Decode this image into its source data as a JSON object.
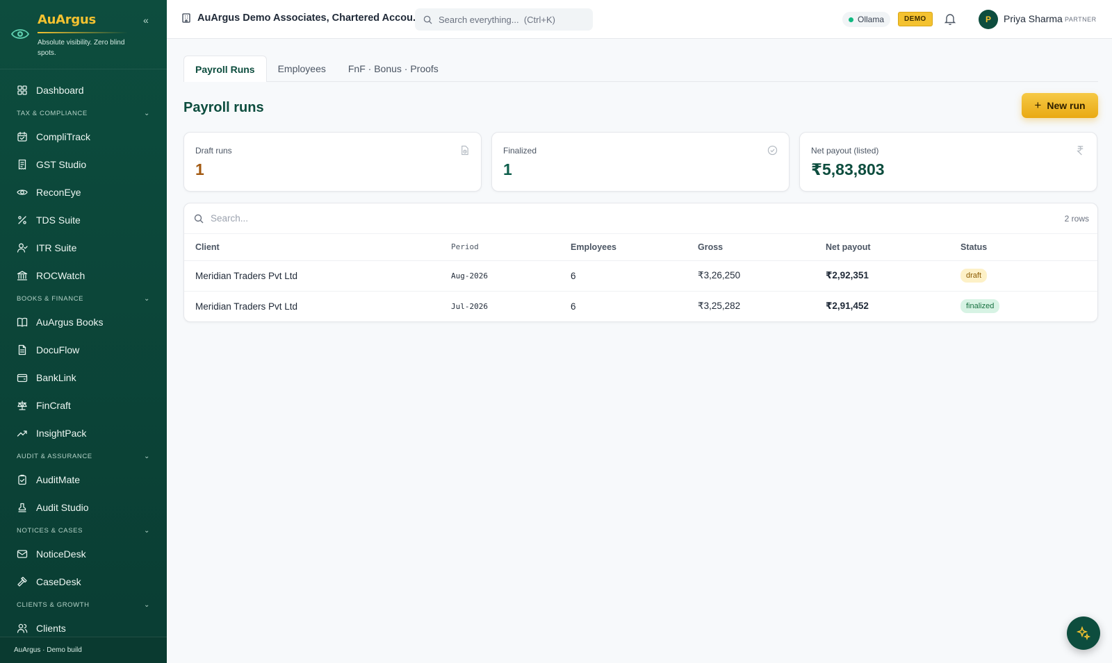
{
  "brand": {
    "name": "AuArgus",
    "tagline": "Absolute visibility. Zero blind spots.",
    "footer": "AuArgus · Demo build"
  },
  "sidebar": {
    "items": [
      {
        "type": "item",
        "label": "Dashboard",
        "icon": "grid-icon"
      },
      {
        "type": "section",
        "label": "Tax & Compliance"
      },
      {
        "type": "item",
        "label": "CompliTrack",
        "icon": "calendar-check-icon"
      },
      {
        "type": "item",
        "label": "GST Studio",
        "icon": "receipt-icon"
      },
      {
        "type": "item",
        "label": "ReconEye",
        "icon": "eye-icon"
      },
      {
        "type": "item",
        "label": "TDS Suite",
        "icon": "percent-icon"
      },
      {
        "type": "item",
        "label": "ITR Suite",
        "icon": "user-check-icon"
      },
      {
        "type": "item",
        "label": "ROCWatch",
        "icon": "bank-building-icon"
      },
      {
        "type": "section",
        "label": "Books & Finance"
      },
      {
        "type": "item",
        "label": "AuArgus Books",
        "icon": "book-open-icon"
      },
      {
        "type": "item",
        "label": "DocuFlow",
        "icon": "file-text-icon"
      },
      {
        "type": "item",
        "label": "BankLink",
        "icon": "wallet-icon"
      },
      {
        "type": "item",
        "label": "FinCraft",
        "icon": "scale-icon"
      },
      {
        "type": "item",
        "label": "InsightPack",
        "icon": "trending-up-icon"
      },
      {
        "type": "section",
        "label": "Audit & Assurance"
      },
      {
        "type": "item",
        "label": "AuditMate",
        "icon": "clipboard-check-icon"
      },
      {
        "type": "item",
        "label": "Audit Studio",
        "icon": "stamp-icon"
      },
      {
        "type": "section",
        "label": "Notices & Cases"
      },
      {
        "type": "item",
        "label": "NoticeDesk",
        "icon": "mail-icon"
      },
      {
        "type": "item",
        "label": "CaseDesk",
        "icon": "gavel-icon"
      },
      {
        "type": "section",
        "label": "Clients & Growth"
      },
      {
        "type": "item",
        "label": "Clients",
        "icon": "users-icon"
      }
    ]
  },
  "header": {
    "org_name": "AuArgus Demo Associates, Chartered Accou...",
    "search_placeholder": "Search everything...  (Ctrl+K)",
    "ollama_label": "Ollama",
    "demo_badge": "DEMO",
    "user_initial": "P",
    "user_name": "Priya Sharma",
    "user_role": "PARTNER"
  },
  "tabs": [
    {
      "label": "Payroll Runs",
      "active": true
    },
    {
      "label": "Employees",
      "active": false
    },
    {
      "label": "FnF · Bonus · Proofs",
      "active": false
    }
  ],
  "page": {
    "title": "Payroll runs",
    "new_run_label": "New run"
  },
  "stats": [
    {
      "label": "Draft runs",
      "value": "1",
      "color": "#a35a12",
      "icon": "draft-icon"
    },
    {
      "label": "Finalized",
      "value": "1",
      "color": "#0d5e4b",
      "icon": "check-circle-icon"
    },
    {
      "label": "Net payout (listed)",
      "value": "₹5,83,803",
      "color": "#0d4d3e",
      "icon": "rupee-icon"
    }
  ],
  "table": {
    "search_placeholder": "Search...",
    "rows_count": "2 rows",
    "columns": [
      "Client",
      "Period",
      "Employees",
      "Gross",
      "Net payout",
      "Status"
    ],
    "rows": [
      {
        "client": "Meridian Traders Pvt Ltd",
        "period": "Aug-2026",
        "employees": "6",
        "gross": "₹3,26,250",
        "net": "₹2,92,351",
        "status": "draft"
      },
      {
        "client": "Meridian Traders Pvt Ltd",
        "period": "Jul-2026",
        "employees": "6",
        "gross": "₹3,25,282",
        "net": "₹2,91,452",
        "status": "finalized"
      }
    ]
  },
  "colors": {
    "sidebar_bg": "#0d4d3e",
    "accent_gold": "#f4c230",
    "brand_green": "#0d4d3e"
  }
}
